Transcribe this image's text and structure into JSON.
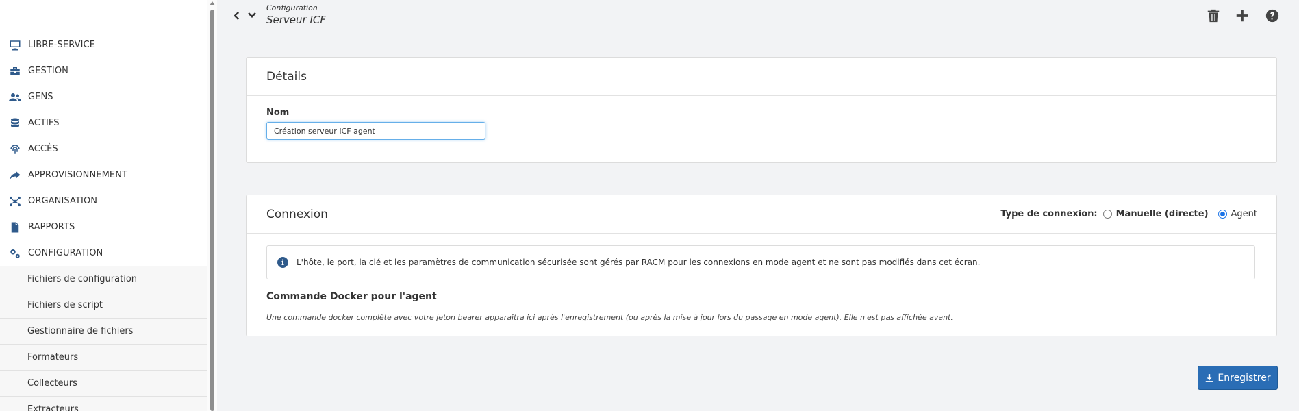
{
  "sidebar": {
    "items": [
      {
        "label": "LIBRE-SERVICE",
        "icon": "monitor-icon"
      },
      {
        "label": "GESTION",
        "icon": "toolbox-icon"
      },
      {
        "label": "GENS",
        "icon": "users-icon"
      },
      {
        "label": "ACTIFS",
        "icon": "database-icon"
      },
      {
        "label": "ACCÈS",
        "icon": "fingerprint-icon"
      },
      {
        "label": "APPROVISIONNEMENT",
        "icon": "share-icon"
      },
      {
        "label": "ORGANISATION",
        "icon": "network-icon"
      },
      {
        "label": "RAPPORTS",
        "icon": "file-icon"
      },
      {
        "label": "CONFIGURATION",
        "icon": "gears-icon"
      }
    ],
    "sub_items": [
      {
        "label": "Fichiers de configuration"
      },
      {
        "label": "Fichiers de script"
      },
      {
        "label": "Gestionnaire de fichiers"
      },
      {
        "label": "Formateurs"
      },
      {
        "label": "Collecteurs"
      },
      {
        "label": "Extracteurs"
      }
    ]
  },
  "header": {
    "breadcrumb_parent": "Configuration",
    "page_title": "Serveur ICF"
  },
  "details": {
    "title": "Détails",
    "name_label": "Nom",
    "name_value": "Création serveur ICF agent"
  },
  "connexion": {
    "title": "Connexion",
    "type_label": "Type de connexion:",
    "options": [
      {
        "label": "Manuelle (directe)",
        "selected": false
      },
      {
        "label": "Agent",
        "selected": true
      }
    ],
    "info_text": "L'hôte, le port, la clé et les paramètres de communication sécurisée sont gérés par RACM pour les connexions en mode agent et ne sont pas modifiés dans cet écran.",
    "docker_title": "Commande Docker pour l'agent",
    "docker_desc": "Une commande docker complète avec votre jeton bearer apparaîtra ici après l'enregistrement (ou après la mise à jour lors du passage en mode agent). Elle n'est pas affichée avant."
  },
  "actions": {
    "save_label": "Enregistrer"
  },
  "colors": {
    "accent": "#2a6db5",
    "icon_blue": "#2f5a8b",
    "focus": "#66afe9"
  }
}
